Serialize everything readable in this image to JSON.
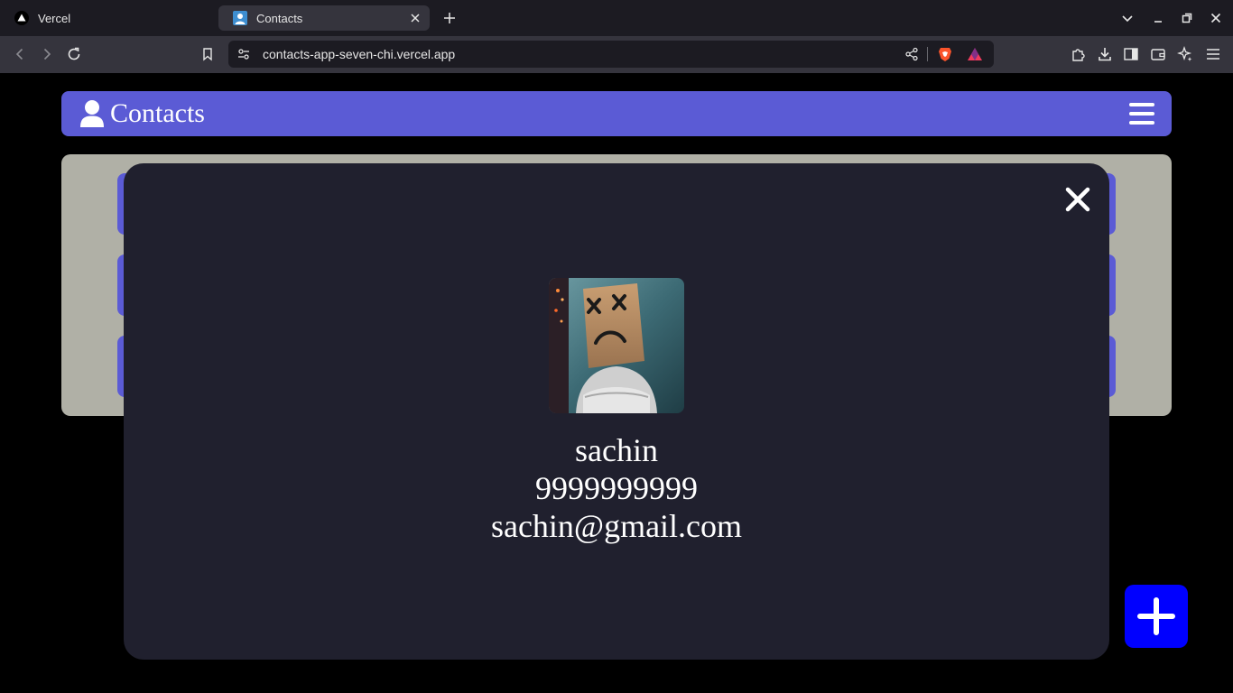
{
  "browser": {
    "tabs": [
      {
        "title": "Vercel",
        "icon": "vercel-triangle-icon",
        "active": false
      },
      {
        "title": "Contacts",
        "icon": "contact-person-icon",
        "active": true
      }
    ],
    "url": "contacts-app-seven-chi.vercel.app"
  },
  "app": {
    "title": "Contacts",
    "colors": {
      "header": "#5b5bd5",
      "panel": "#b0b0a6",
      "modal": "#20202e",
      "fab": "#0000ff"
    }
  },
  "list": {
    "cards": [
      {},
      {},
      {}
    ]
  },
  "modal": {
    "name": "sachin",
    "phone": "9999999999",
    "email": "sachin@gmail.com"
  }
}
